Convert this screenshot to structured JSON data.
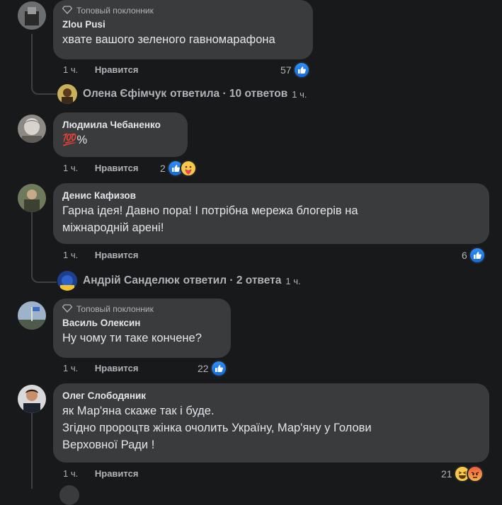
{
  "badge_label": "Топовый поклонник",
  "comments": [
    {
      "author": "Zlou Pusi",
      "top_fan": true,
      "lines": [
        "хвате вашого зеленого гавномарафона"
      ],
      "time": "1 ч.",
      "like_label": "Нравится",
      "reaction_count": "57",
      "reactions": [
        "like-icon"
      ],
      "replies": {
        "name": "Олена Єфімчук",
        "action": "ответила · 10 ответов",
        "time": "1 ч."
      }
    },
    {
      "author": "Людмила Чебаненко",
      "top_fan": false,
      "lines": [
        "💯%"
      ],
      "time": "1 ч.",
      "like_label": "Нравится",
      "reaction_count": "2",
      "reactions": [
        "like-icon",
        "care-icon"
      ]
    },
    {
      "author": "Денис Кафизов",
      "top_fan": false,
      "lines": [
        "Гарна ідея! Давно пора! І потрібна мережа блогерів на",
        "міжнародній арені!"
      ],
      "time": "1 ч.",
      "like_label": "Нравится",
      "reaction_count": "6",
      "reactions": [
        "like-icon"
      ],
      "replies": {
        "name": "Андрій Санделюк",
        "action": "ответил · 2 ответа",
        "time": "1 ч."
      }
    },
    {
      "author": "Василь Олексин",
      "top_fan": true,
      "lines": [
        "Ну чому ти таке кончене?"
      ],
      "time": "1 ч.",
      "like_label": "Нравится",
      "reaction_count": "22",
      "reactions": [
        "like-icon"
      ]
    },
    {
      "author": "Олег Слободяник",
      "top_fan": false,
      "lines": [
        "як Мар'яна скаже так і буде.",
        "Згідно пророцтв жінка очолить Україну, Мар'яну у Голови",
        "Верховної Ради !"
      ],
      "time": "1 ч.",
      "like_label": "Нравится",
      "reaction_count": "21",
      "reactions": [
        "haha-icon",
        "angry-icon"
      ]
    }
  ],
  "colors": {
    "background": "#18191a",
    "bubble": "#3a3b3c",
    "text": "#e4e6eb",
    "secondary_text": "#b0b3b8",
    "like_blue": "#1877f2"
  }
}
